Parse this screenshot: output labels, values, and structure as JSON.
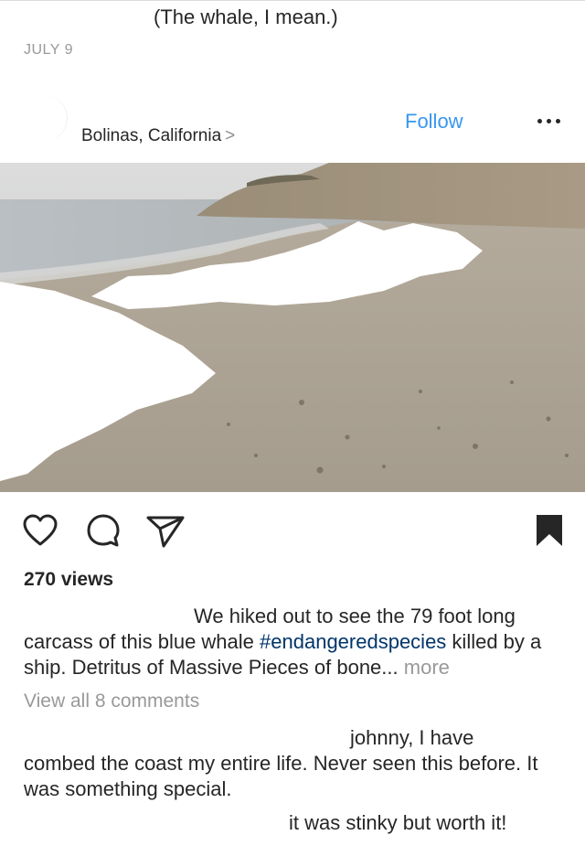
{
  "previous_post": {
    "caption_tail": "(The whale, I mean.)",
    "date": "JULY 9"
  },
  "post": {
    "location": "Bolinas, California",
    "location_chevron": ">",
    "follow_label": "Follow",
    "image_icon": "beach-photo",
    "views": "270 views",
    "caption": {
      "text_1": "We hiked out to see the 79 foot long",
      "text_2": "carcass of this blue whale ",
      "hashtag": "#endangeredspecies",
      "text_3": " killed by a ship. Detritus of Massive Pieces of bone...",
      "more": "more"
    },
    "view_comments": "View all 8 comments",
    "comments": [
      {
        "line1": "johnny, I have",
        "rest": "combed the coast my entire life. Never seen this before. It was something special."
      },
      {
        "text": "it was stinky but worth it!"
      }
    ]
  },
  "icons": {
    "like": "heart-icon",
    "comment": "comment-icon",
    "share": "send-icon",
    "save": "bookmark-icon",
    "menu": "more-dots-icon"
  },
  "colors": {
    "link_blue": "#3897f0",
    "hashtag": "#003569",
    "muted": "#999999",
    "text": "#262626"
  }
}
